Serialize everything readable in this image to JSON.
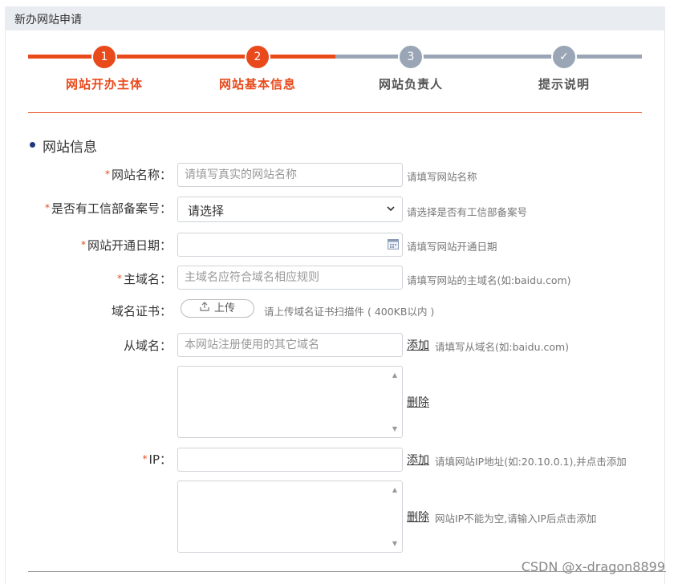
{
  "panel": {
    "title": "新办网站申请"
  },
  "steps": [
    {
      "number": "1",
      "label": "网站开办主体",
      "state": "done"
    },
    {
      "number": "2",
      "label": "网站基本信息",
      "state": "done"
    },
    {
      "number": "3",
      "label": "网站负责人",
      "state": "todo"
    },
    {
      "number": "✓",
      "label": "提示说明",
      "state": "todo"
    }
  ],
  "colors": {
    "accent": "#e84a1c",
    "inactive": "#9aa6b6"
  },
  "section": {
    "title": "网站信息"
  },
  "form": {
    "required_mark": "*",
    "site_name": {
      "label": "网站名称：",
      "placeholder": "请填写真实的网站名称",
      "hint": "请填写网站名称"
    },
    "icp": {
      "label": "是否有工信部备案号：",
      "value": "请选择",
      "hint": "请选择是否有工信部备案号"
    },
    "open_date": {
      "label": "网站开通日期：",
      "hint": "请填写网站开通日期"
    },
    "main_domain": {
      "label": "主域名：",
      "placeholder": "主域名应符合域名相应规则",
      "hint": "请填写网站的主域名(如:baidu.com)"
    },
    "domain_cert": {
      "label": "域名证书：",
      "button": "上传",
      "hint": "请上传域名证书扫描件 ( 400KB以内 )"
    },
    "sub_domain": {
      "label": "从域名：",
      "placeholder": "本网站注册使用的其它域名",
      "add": "添加",
      "hint": "请填写从域名(如:baidu.com)",
      "delete": "删除"
    },
    "ip": {
      "label": "IP：",
      "add": "添加",
      "hint": "请填网站IP地址(如:20.10.0.1),并点击添加",
      "delete": "删除",
      "delete_hint": "网站IP不能为空,请输入IP后点击添加"
    }
  },
  "watermark": "CSDN @x-dragon8899"
}
